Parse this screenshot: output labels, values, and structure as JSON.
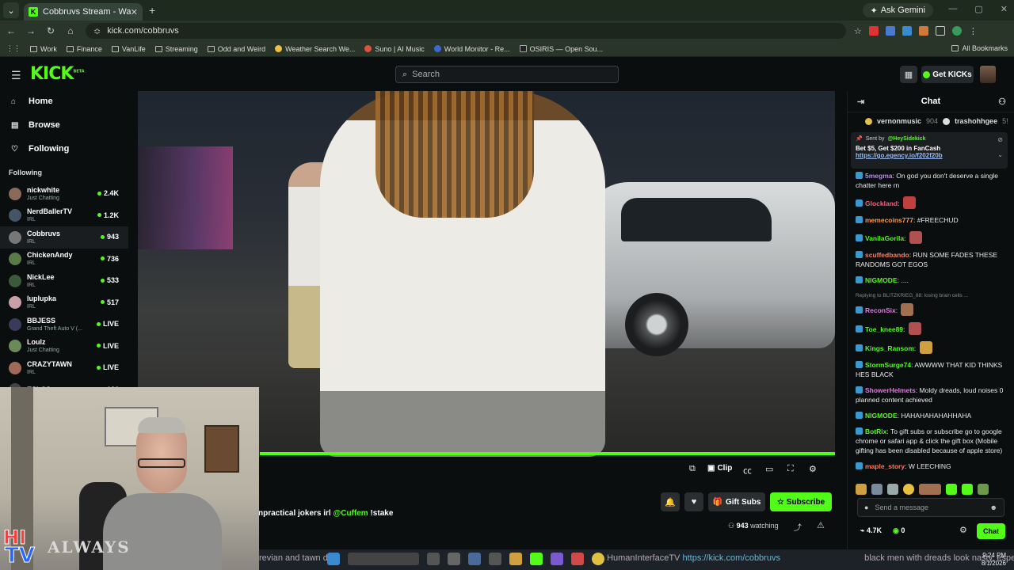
{
  "browser": {
    "tab_title": "Cobbruvs Stream - Watch Live",
    "tab_favicon_letter": "K",
    "url": "kick.com/cobbruvs",
    "ask_gemini": "Ask Gemini",
    "bookmarks": [
      "Work",
      "Finance",
      "VanLife",
      "Streaming",
      "Odd and Weird",
      "Weather Search We...",
      "Suno | AI Music",
      "World Monitor - Re...",
      "OSIRIS — Open Sou..."
    ],
    "all_bookmarks": "All Bookmarks"
  },
  "header": {
    "logo": "KICK",
    "logo_beta": "BETA",
    "search_placeholder": "Search",
    "get_kicks": "Get KICKs"
  },
  "sidebar": {
    "nav": [
      {
        "label": "Home",
        "icon": "home-icon"
      },
      {
        "label": "Browse",
        "icon": "browse-icon"
      },
      {
        "label": "Following",
        "icon": "heart-icon"
      }
    ],
    "following_heading": "Following",
    "channels": [
      {
        "name": "nickwhite",
        "sub": "Just Chatting",
        "count": "2.4K",
        "color": "#8a6a5a"
      },
      {
        "name": "NerdBallerTV",
        "sub": "IRL",
        "count": "1.2K",
        "color": "#445566"
      },
      {
        "name": "Cobbruvs",
        "sub": "IRL",
        "count": "943",
        "color": "#777"
      },
      {
        "name": "ChickenAndy",
        "sub": "IRL",
        "count": "736",
        "color": "#5a7a4a"
      },
      {
        "name": "NickLee",
        "sub": "IRL",
        "count": "533",
        "color": "#3a5a3a"
      },
      {
        "name": "luplupka",
        "sub": "IRL",
        "count": "517",
        "color": "#c9a0a8"
      },
      {
        "name": "BBJESS",
        "sub": "Grand Theft Auto V (...",
        "count": "LIVE",
        "color": "#3a3a5a"
      },
      {
        "name": "Loulz",
        "sub": "Just Chatting",
        "count": "LIVE",
        "color": "#6a8a5a"
      },
      {
        "name": "CRAZYTAWN",
        "sub": "IRL",
        "count": "LIVE",
        "color": "#a06a5a"
      },
      {
        "name": "ESLCS",
        "sub": "",
        "count": "126",
        "color": "#444"
      }
    ]
  },
  "player": {
    "clip_label": "Clip",
    "progress": 1.0
  },
  "stream": {
    "title_prefix": "npractical jokers irl ",
    "title_mention": "@Cuffem",
    "title_suffix": " !stake",
    "gift_subs": "Gift Subs",
    "subscribe": "Subscribe",
    "viewers": "943",
    "watching_label": "watching"
  },
  "webcam": {
    "shirt_text": "ALWAYS",
    "logo_top": "HI",
    "logo_bottom": "TV"
  },
  "chat": {
    "title": "Chat",
    "gifters": [
      {
        "name": "vernonmusic",
        "value": "904"
      },
      {
        "name": "trashohhgee",
        "value": "5!"
      }
    ],
    "pinned": {
      "sent_by": "Sent by",
      "sender": "@HeySidekick",
      "text": "Bet $5, Get $200 in FanCash",
      "link": "https://go.egency.io/f202f20b"
    },
    "messages": [
      {
        "user": "5megma",
        "color": "#b98be8",
        "text": "On god you don't deserve a single chatter here rn"
      },
      {
        "user": "Glockland",
        "color": "#ff5a7a",
        "text": ""
      },
      {
        "user": "memecoins777",
        "color": "#ff9a3a",
        "text": "#FREECHUD"
      },
      {
        "user": "VanilaGorila",
        "color": "#53fc18",
        "text": ""
      },
      {
        "user": "scuffedbando",
        "color": "#ff7a5a",
        "text": "RUN SOME FADES THESE RANDOMS GOT EGOS"
      },
      {
        "user": "NIGMODE",
        "color": "#53fc18",
        "text": "...."
      },
      {
        "user": "ReconSix",
        "color": "#e07ae0",
        "text": "",
        "reply": "Replying to BLITZKRIEG_88: losing brain cells ..."
      },
      {
        "user": "Toe_knee89",
        "color": "#53fc18",
        "text": ""
      },
      {
        "user": "Kings_Ransom",
        "color": "#53fc18",
        "text": ""
      },
      {
        "user": "StormSurge74",
        "color": "#53fc18",
        "text": "AWWWW THAT KID THINKS HES BLACK"
      },
      {
        "user": "ShowerHelmets",
        "color": "#e07ae0",
        "text": "Moldy dreads, loud noises 0 planned content achieved"
      },
      {
        "user": "NIGMODE",
        "color": "#53fc18",
        "text": "HAHAHAHAHAHHAHA"
      },
      {
        "user": "BotRix",
        "color": "#53fc18",
        "text": "To gift subs or subscribe go to google chrome or safari app & click the gift box (Mobile gifting has been disabled because of apple store)"
      },
      {
        "user": "maple_story",
        "color": "#ff7a5a",
        "text": "W LEECHING"
      }
    ],
    "input_placeholder": "Send a message",
    "kicks_count": "4.7K",
    "points": "0",
    "chat_button": "Chat"
  },
  "taskbar": {
    "ticker": "revian and tawn do",
    "ticker2": "HumanInterfaceTV",
    "ticker_url": "https://kick.com/cobbruvs",
    "ticker3": "black men with dreads look nasty, especially when it's dyed",
    "time": "9:24 PM",
    "date": "8/1/2026"
  }
}
